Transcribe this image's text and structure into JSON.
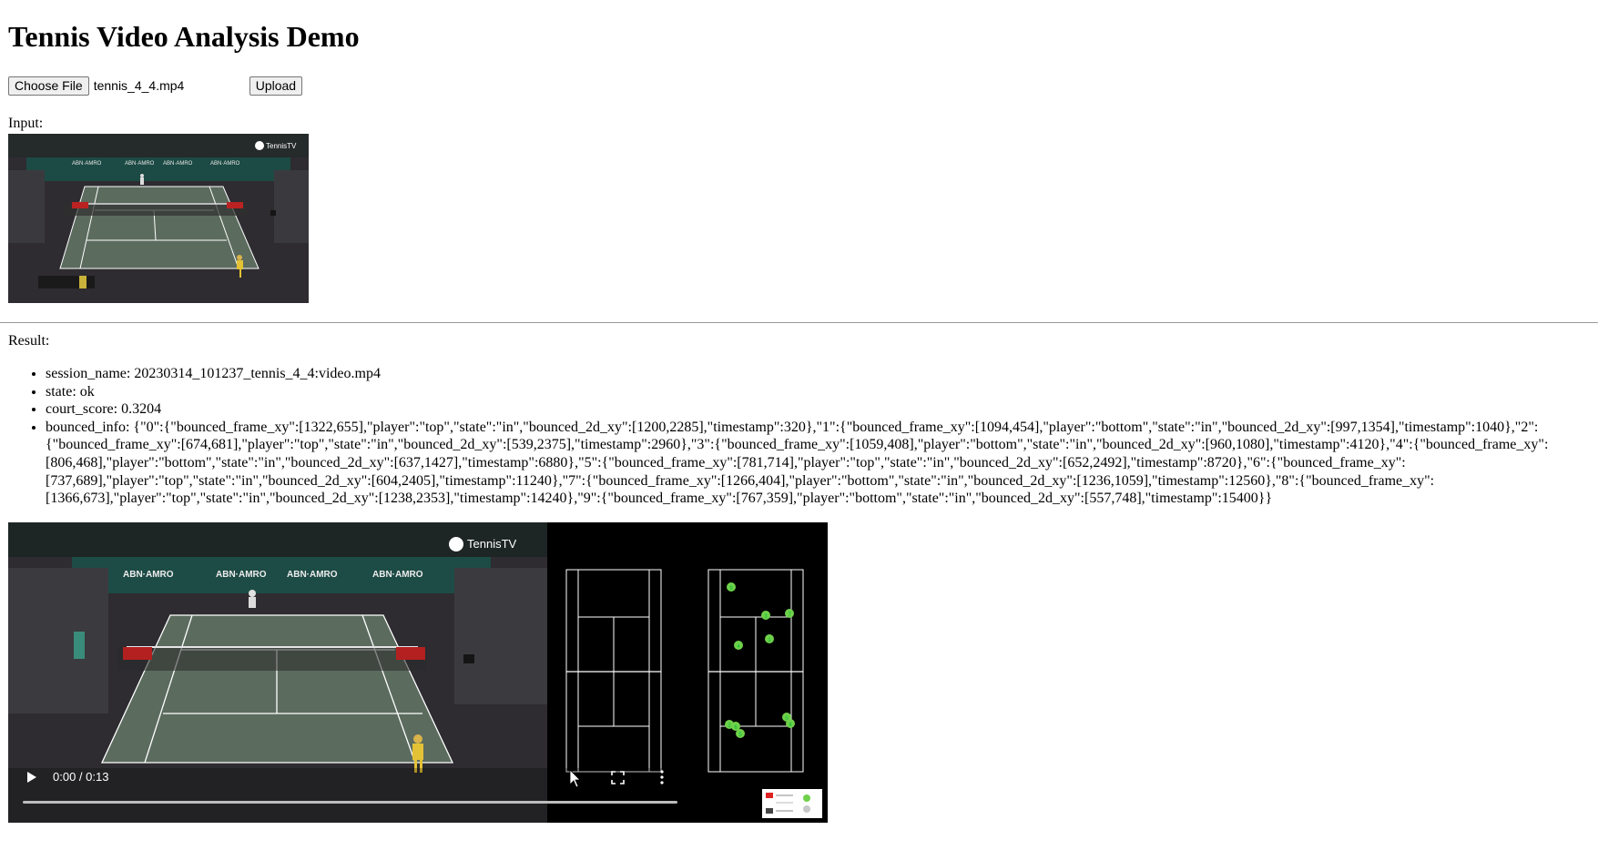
{
  "page": {
    "title": "Tennis Video Analysis Demo"
  },
  "upload": {
    "choose_label": "Choose File",
    "file_name": "tennis_4_4.mp4",
    "upload_label": "Upload"
  },
  "input": {
    "label": "Input:",
    "thumbnail": {
      "brand": "TennisTV",
      "banners": [
        "ABN·AMRO",
        "ABN·AMRO",
        "ABN·AMRO",
        "ABN·AMRO"
      ]
    }
  },
  "result": {
    "label": "Result:",
    "items": [
      {
        "key": "session_name",
        "text": "session_name: 20230314_101237_tennis_4_4:video.mp4"
      },
      {
        "key": "state",
        "text": "state: ok"
      },
      {
        "key": "court_score",
        "text": "court_score: 0.3204"
      },
      {
        "key": "bounced_info",
        "text": "bounced_info: {\"0\":{\"bounced_frame_xy\":[1322,655],\"player\":\"top\",\"state\":\"in\",\"bounced_2d_xy\":[1200,2285],\"timestamp\":320},\"1\":{\"bounced_frame_xy\":[1094,454],\"player\":\"bottom\",\"state\":\"in\",\"bounced_2d_xy\":[997,1354],\"timestamp\":1040},\"2\":{\"bounced_frame_xy\":[674,681],\"player\":\"top\",\"state\":\"in\",\"bounced_2d_xy\":[539,2375],\"timestamp\":2960},\"3\":{\"bounced_frame_xy\":[1059,408],\"player\":\"bottom\",\"state\":\"in\",\"bounced_2d_xy\":[960,1080],\"timestamp\":4120},\"4\":{\"bounced_frame_xy\":[806,468],\"player\":\"bottom\",\"state\":\"in\",\"bounced_2d_xy\":[637,1427],\"timestamp\":6880},\"5\":{\"bounced_frame_xy\":[781,714],\"player\":\"top\",\"state\":\"in\",\"bounced_2d_xy\":[652,2492],\"timestamp\":8720},\"6\":{\"bounced_frame_xy\":[737,689],\"player\":\"top\",\"state\":\"in\",\"bounced_2d_xy\":[604,2405],\"timestamp\":11240},\"7\":{\"bounced_frame_xy\":[1266,404],\"player\":\"bottom\",\"state\":\"in\",\"bounced_2d_xy\":[1236,1059],\"timestamp\":12560},\"8\":{\"bounced_frame_xy\":[1366,673],\"player\":\"top\",\"state\":\"in\",\"bounced_2d_xy\":[1238,2353],\"timestamp\":14240},\"9\":{\"bounced_frame_xy\":[767,359],\"player\":\"bottom\",\"state\":\"in\",\"bounced_2d_xy\":[557,748],\"timestamp\":15400}}"
      }
    ]
  },
  "video": {
    "brand": "TennisTV",
    "banners": [
      "ABN·AMRO",
      "ABN·AMRO",
      "ABN·AMRO",
      "ABN·AMRO"
    ],
    "time_display": "0:00 / 0:13",
    "progress": 0,
    "bounce_markers": [
      "0",
      "1",
      "2",
      "3",
      "4",
      "5",
      "6",
      "7",
      "8",
      "9"
    ],
    "colors": {
      "court": "#5b6b5e",
      "marker": "#6fd14a",
      "background": "#000000"
    }
  }
}
